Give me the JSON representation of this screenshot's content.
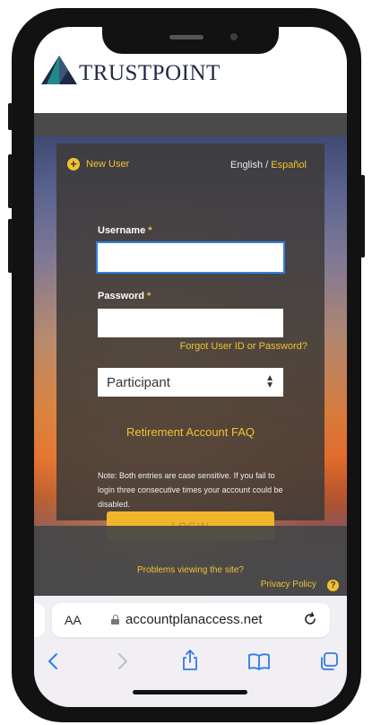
{
  "header": {
    "logo_text": "TRUSTPOINT",
    "brand_navy": "#1f2a44",
    "brand_teal": "#1f8a8a"
  },
  "login": {
    "new_user_label": "New User",
    "lang_english": "English",
    "lang_separator": " / ",
    "lang_spanish": "Español",
    "username_label": "Username",
    "password_label": "Password",
    "required_marker": " *",
    "username_value": "",
    "password_value": "",
    "forgot_link": "Forgot User ID or Password?",
    "role_select_value": "Participant",
    "faq_link": "Retirement Account FAQ",
    "note": "Note: Both entries are case sensitive. If you fail to login three consecutive times your account could be disabled.",
    "login_button": "LOGIN",
    "accent_color": "#f2c230"
  },
  "footer": {
    "problems_link": "Problems viewing the site?",
    "privacy_link": "Privacy Policy",
    "help_icon_label": "?"
  },
  "safari": {
    "text_size_label": "AA",
    "url": "accountplanaccess.net",
    "icons": [
      "back-icon",
      "forward-icon",
      "share-icon",
      "bookmarks-icon",
      "tabs-icon",
      "reload-icon",
      "lock-icon"
    ]
  }
}
